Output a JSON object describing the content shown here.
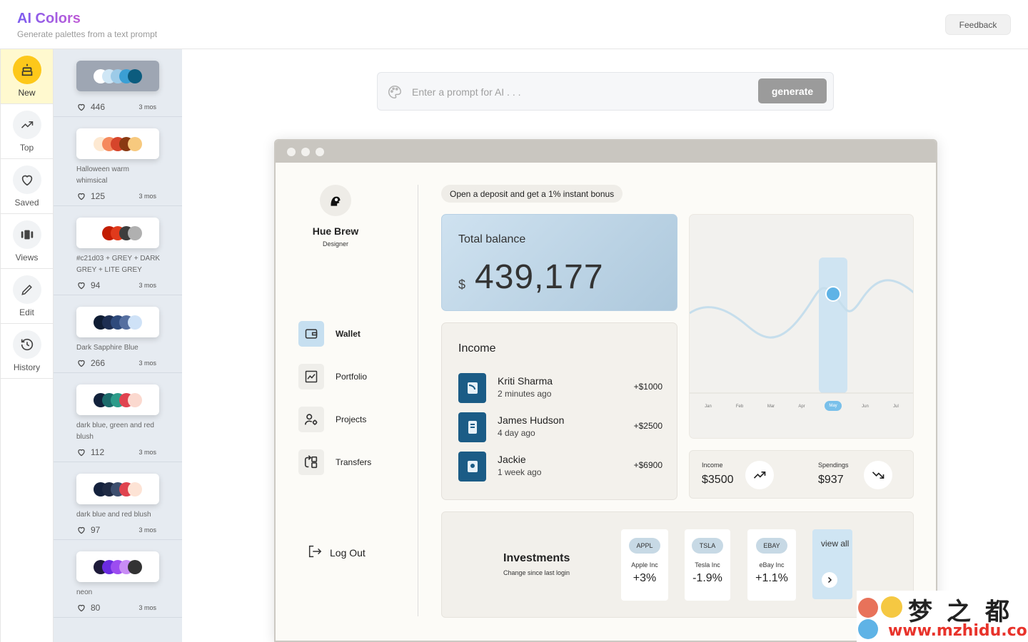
{
  "header": {
    "logo": "AI Colors",
    "tagline": "Generate palettes from a text prompt",
    "feedback_label": "Feedback"
  },
  "nav": {
    "items": [
      {
        "label": "New",
        "icon": "cake-icon"
      },
      {
        "label": "Top",
        "icon": "trending-up-icon"
      },
      {
        "label": "Saved",
        "icon": "heart-icon"
      },
      {
        "label": "Views",
        "icon": "carousel-icon"
      },
      {
        "label": "Edit",
        "icon": "pencil-icon"
      },
      {
        "label": "History",
        "icon": "history-icon"
      }
    ]
  },
  "palettes": [
    {
      "name": "",
      "likes": "446",
      "date": "3 mos",
      "colors": [
        "#ffffff",
        "#cfe6f5",
        "#9dcbe8",
        "#3b9fd4",
        "#0c5c7e"
      ]
    },
    {
      "name": "Halloween warm whimsical",
      "likes": "125",
      "date": "3 mos",
      "colors": [
        "#fde9d2",
        "#f58a5e",
        "#d6452b",
        "#8a3a12",
        "#f7c97e"
      ]
    },
    {
      "name": "#c21d03 + GREY + DARK GREY + LITE GREY",
      "likes": "94",
      "date": "3 mos",
      "colors": [
        "#ffffff",
        "#c21d03",
        "#e03a1c",
        "#3d3d3d",
        "#b0b0b0"
      ]
    },
    {
      "name": "Dark Sapphire Blue",
      "likes": "266",
      "date": "3 mos",
      "colors": [
        "#0f1c33",
        "#1d2e52",
        "#2e4a7c",
        "#556fa0",
        "#cfe2f7"
      ]
    },
    {
      "name": "dark blue, green and red blush",
      "likes": "112",
      "date": "3 mos",
      "colors": [
        "#12223b",
        "#1c6b6b",
        "#2d9c8a",
        "#e0434f",
        "#fbd9cf"
      ]
    },
    {
      "name": "dark blue and red blush",
      "likes": "97",
      "date": "3 mos",
      "colors": [
        "#14213d",
        "#1f2a44",
        "#3d4e6e",
        "#e0434f",
        "#fde3d5"
      ]
    },
    {
      "name": "neon",
      "likes": "80",
      "date": "3 mos",
      "colors": [
        "#1e1b3a",
        "#6a2ce0",
        "#9c4df0",
        "#c88cf5",
        "#333333"
      ]
    }
  ],
  "prompt": {
    "placeholder": "Enter a prompt for AI . . .",
    "button": "generate"
  },
  "preview": {
    "profile": {
      "name": "Hue Brew",
      "role": "Designer"
    },
    "menu": [
      {
        "label": "Wallet",
        "icon": "wallet-icon"
      },
      {
        "label": "Portfolio",
        "icon": "chart-icon"
      },
      {
        "label": "Projects",
        "icon": "user-settings-icon"
      },
      {
        "label": "Transfers",
        "icon": "transfer-icon"
      }
    ],
    "logout": "Log Out",
    "promo": "Open a deposit and get a 1% instant bonus",
    "balance": {
      "title": "Total balance",
      "currency": "$",
      "value": "439,177"
    },
    "income": {
      "title": "Income",
      "transactions": [
        {
          "name": "Kriti Sharma",
          "time": "2 minutes ago",
          "amount": "+$1000"
        },
        {
          "name": "James Hudson",
          "time": "4 day ago",
          "amount": "+$2500"
        },
        {
          "name": "Jackie",
          "time": "1 week ago",
          "amount": "+$6900"
        }
      ]
    },
    "chart": {
      "months": [
        "Jan",
        "Feb",
        "Mar",
        "Apr",
        "May",
        "Jun",
        "Jul"
      ],
      "selected": "May"
    },
    "summary": {
      "income_label": "Income",
      "income_value": "$3500",
      "spend_label": "Spendings",
      "spend_value": "$937"
    },
    "investments": {
      "title": "Investments",
      "subtitle": "Change since last login",
      "stocks": [
        {
          "ticker": "APPL",
          "name": "Apple Inc",
          "change": "+3%"
        },
        {
          "ticker": "TSLA",
          "name": "Tesla Inc",
          "change": "-1.9%"
        },
        {
          "ticker": "EBAY",
          "name": "eBay Inc",
          "change": "+1.1%"
        }
      ],
      "view_all": "view all"
    }
  },
  "watermark": {
    "cn": "梦之都",
    "url": "www.mzhidu.com"
  }
}
